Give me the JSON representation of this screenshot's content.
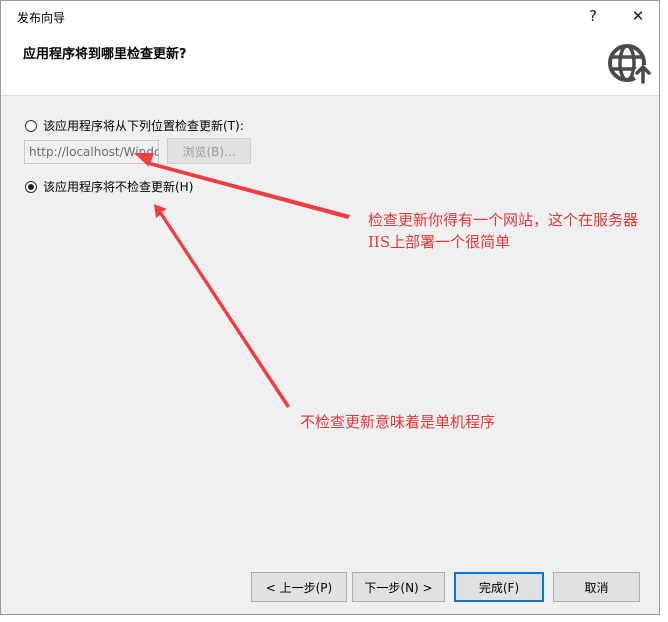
{
  "window": {
    "title": "发布向导",
    "help_label": "?",
    "close_label": "✕"
  },
  "header": {
    "title": "应用程序将到哪里检查更新?"
  },
  "options": {
    "check_location_label": "该应用程序将从下列位置检查更新(T):",
    "url_value": "http://localhost/Windc",
    "browse_label": "浏览(B)...",
    "no_check_label": "该应用程序将不检查更新(H)",
    "selected": "no_check"
  },
  "annotations": {
    "note1": "检查更新你得有一个网站，这个在服务器IIS上部署一个很简单",
    "note2": "不检查更新意味着是单机程序",
    "color": "#e2373a"
  },
  "footer": {
    "prev_label": "< 上一步(P)",
    "next_label": "下一步(N) >",
    "finish_label": "完成(F)",
    "cancel_label": "取消"
  },
  "colors": {
    "accent": "#0078d7",
    "globe": "#4a4a4a"
  },
  "icons": {
    "header": "globe-update-icon"
  }
}
